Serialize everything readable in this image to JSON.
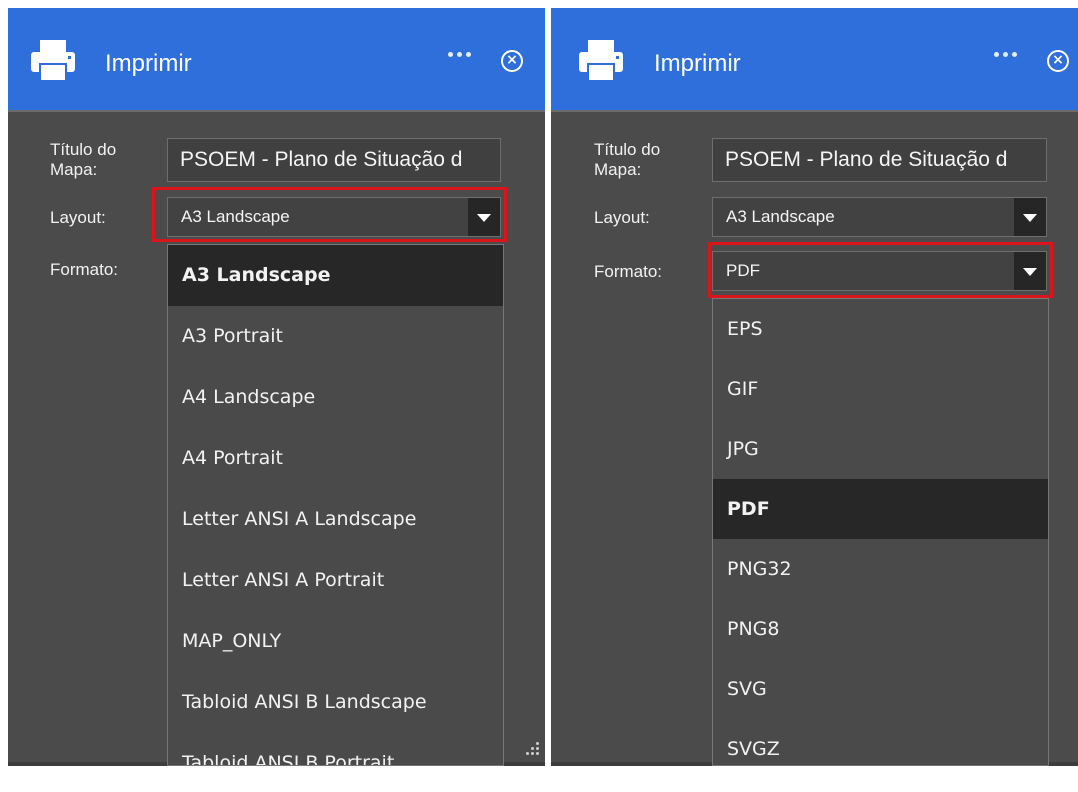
{
  "left_panel": {
    "title": "Imprimir",
    "map_title_label": "Título do Mapa:",
    "map_title_value": "PSOEM - Plano de Situação d",
    "layout_label": "Layout:",
    "layout_value": "A3 Landscape",
    "format_label": "Formato:",
    "layout_options": [
      {
        "label": "A3 Landscape"
      },
      {
        "label": "A3 Portrait"
      },
      {
        "label": "A4 Landscape"
      },
      {
        "label": "A4 Portrait"
      },
      {
        "label": "Letter ANSI A Landscape"
      },
      {
        "label": "Letter ANSI A Portrait"
      },
      {
        "label": "MAP_ONLY"
      },
      {
        "label": "Tabloid ANSI B Landscape"
      },
      {
        "label": "Tabloid ANSI B Portrait"
      }
    ]
  },
  "right_panel": {
    "title": "Imprimir",
    "map_title_label": "Título do Mapa:",
    "map_title_value": "PSOEM - Plano de Situação d",
    "layout_label": "Layout:",
    "layout_value": "A3 Landscape",
    "format_label": "Formato:",
    "format_value": "PDF",
    "format_options": [
      {
        "label": "EPS"
      },
      {
        "label": "GIF"
      },
      {
        "label": "JPG"
      },
      {
        "label": "PDF"
      },
      {
        "label": "PNG32"
      },
      {
        "label": "PNG8"
      },
      {
        "label": "SVG"
      },
      {
        "label": "SVGZ"
      }
    ]
  },
  "colors": {
    "header_blue": "#2e6fdc",
    "panel_bg": "#4b4b4b",
    "highlight_red": "#d9141b",
    "selected_option_bg": "#272727"
  },
  "icons": [
    "printer-icon",
    "more-options-icon",
    "close-icon",
    "chevron-down-icon",
    "resize-grip-icon"
  ]
}
